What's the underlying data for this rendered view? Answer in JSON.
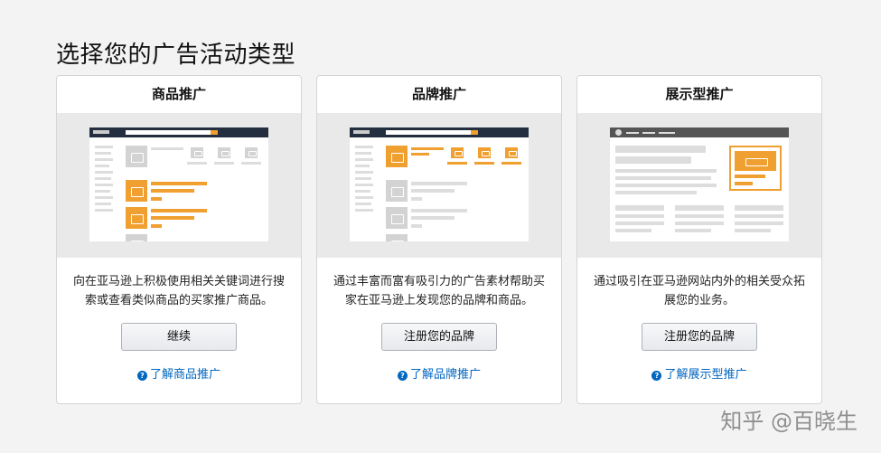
{
  "page": {
    "title": "选择您的广告活动类型"
  },
  "cards": [
    {
      "title": "商品推广",
      "description": "向在亚马逊上积极使用相关关键词进行搜索或查看类似商品的买家推广商品。",
      "button": "继续",
      "learn_more": "了解商品推广"
    },
    {
      "title": "品牌推广",
      "description": "通过丰富而富有吸引力的广告素材帮助买家在亚马逊上发现您的品牌和商品。",
      "button": "注册您的品牌",
      "learn_more": "了解品牌推广"
    },
    {
      "title": "展示型推广",
      "description": "通过吸引在亚马逊网站内外的相关受众拓展您的业务。",
      "button": "注册您的品牌",
      "learn_more": "了解展示型推广"
    }
  ],
  "icons": {
    "help": "help-circle-icon",
    "placeholder": "image-placeholder-icon"
  },
  "colors": {
    "accent": "#f0a030",
    "link": "#0066c0",
    "header_bar": "#232f3e"
  },
  "watermark": "知乎 @百晓生"
}
